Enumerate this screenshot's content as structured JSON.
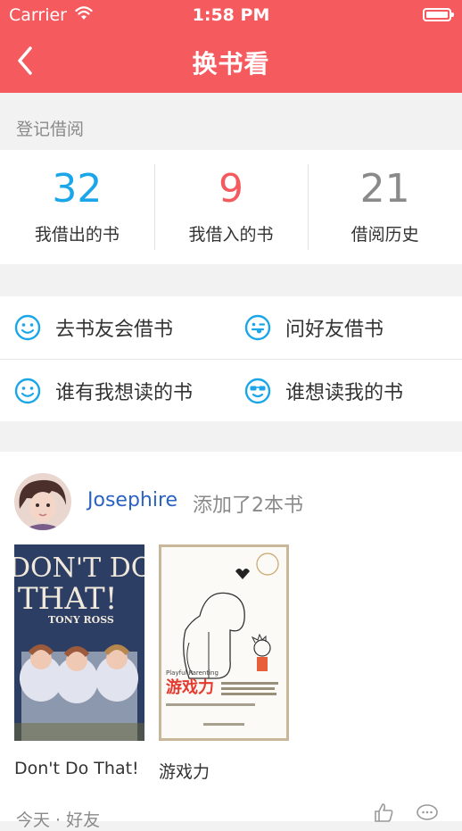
{
  "status_bar": {
    "carrier": "Carrier",
    "time": "1:58 PM"
  },
  "nav": {
    "title": "换书看",
    "back_icon": "chevron-left-icon"
  },
  "section": {
    "label": "登记借阅"
  },
  "stats": [
    {
      "value": "32",
      "label": "我借出的书",
      "color": "#1aa6e8"
    },
    {
      "value": "9",
      "label": "我借入的书",
      "color": "#f55a5e"
    },
    {
      "value": "21",
      "label": "借阅历史",
      "color": "#8a8a8a"
    }
  ],
  "actions": [
    {
      "label": "去书友会借书",
      "icon": "smile-icon"
    },
    {
      "label": "问好友借书",
      "icon": "wink-tongue-icon"
    },
    {
      "label": "谁有我想读的书",
      "icon": "smile-icon"
    },
    {
      "label": "谁想读我的书",
      "icon": "sunglasses-icon"
    }
  ],
  "feed": {
    "user": "Josephire",
    "action": "添加了2本书",
    "books": [
      {
        "title": "Don't Do That!",
        "cover_line1": "DON'T DO",
        "cover_line2": "THAT!",
        "cover_author": "TONY ROSS"
      },
      {
        "title": "游戏力",
        "cover_title": "游戏力",
        "cover_en": "Playful Parenting"
      }
    ],
    "meta": "今天 · 好友"
  },
  "colors": {
    "brand": "#f55a5e",
    "accent_blue": "#1aa6e8",
    "link": "#2a63c2"
  }
}
